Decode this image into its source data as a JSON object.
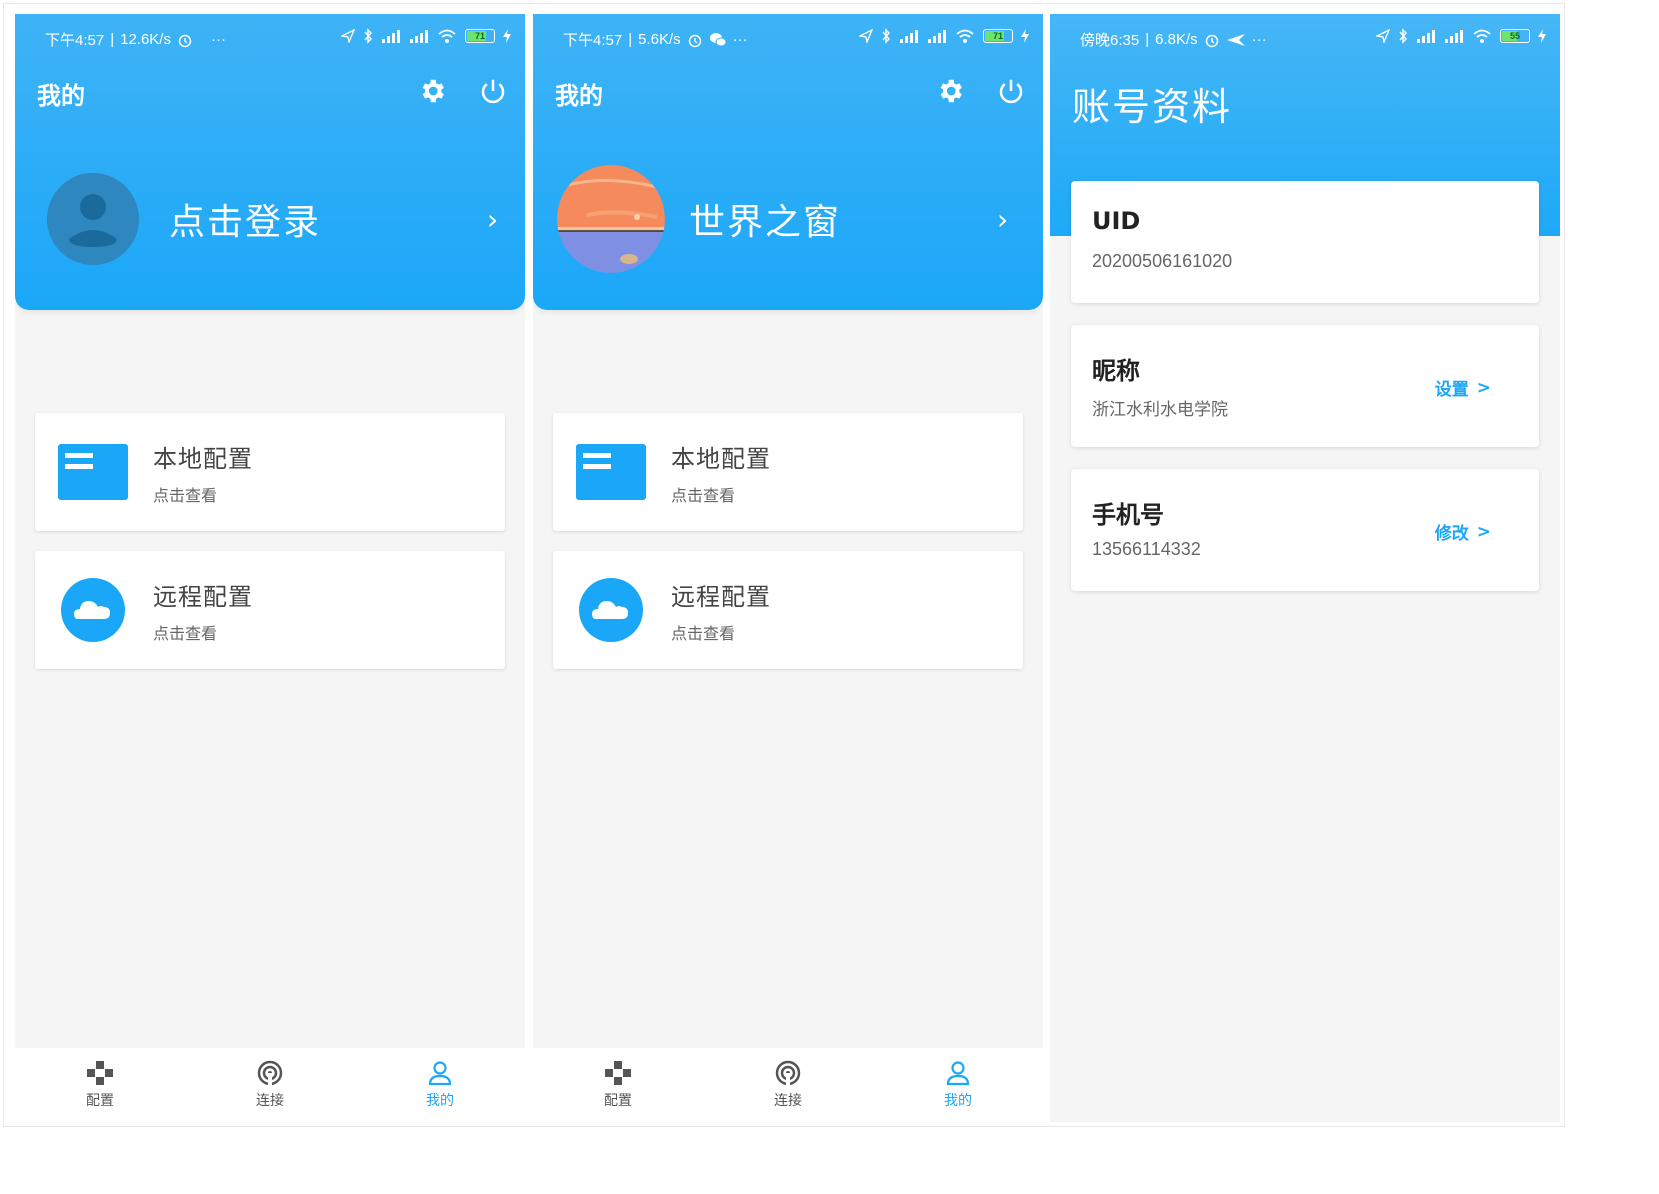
{
  "screens": [
    {
      "status": {
        "time": "下午4:57",
        "speed": "12.6K/s",
        "battery": "71",
        "dots": "···"
      },
      "title": "我的",
      "profile": {
        "name": "点击登录"
      },
      "cards": [
        {
          "title": "本地配置",
          "subtitle": "点击查看"
        },
        {
          "title": "远程配置",
          "subtitle": "点击查看"
        }
      ],
      "nav": [
        {
          "label": "配置"
        },
        {
          "label": "连接"
        },
        {
          "label": "我的"
        }
      ]
    },
    {
      "status": {
        "time": "下午4:57",
        "speed": "5.6K/s",
        "battery": "71",
        "dots": "···"
      },
      "title": "我的",
      "profile": {
        "name": "世界之窗"
      },
      "cards": [
        {
          "title": "本地配置",
          "subtitle": "点击查看"
        },
        {
          "title": "远程配置",
          "subtitle": "点击查看"
        }
      ],
      "nav": [
        {
          "label": "配置"
        },
        {
          "label": "连接"
        },
        {
          "label": "我的"
        }
      ]
    },
    {
      "status": {
        "time": "傍晚6:35",
        "speed": "6.8K/s",
        "battery": "55",
        "dots": "···"
      },
      "title": "账号资料",
      "fields": [
        {
          "label": "UID",
          "value": "20200506161020"
        },
        {
          "label": "昵称",
          "value": "浙江水利水电学院",
          "action": "设置"
        },
        {
          "label": "手机号",
          "value": "13566114332",
          "action": "修改"
        }
      ]
    }
  ],
  "symbols": {
    "chevron": "›",
    "action_chevron": ">",
    "status_sep": "|"
  },
  "colors": {
    "accent": "#1ba7f8",
    "header_top": "#3fb3f6",
    "background": "#f5f5f5"
  }
}
